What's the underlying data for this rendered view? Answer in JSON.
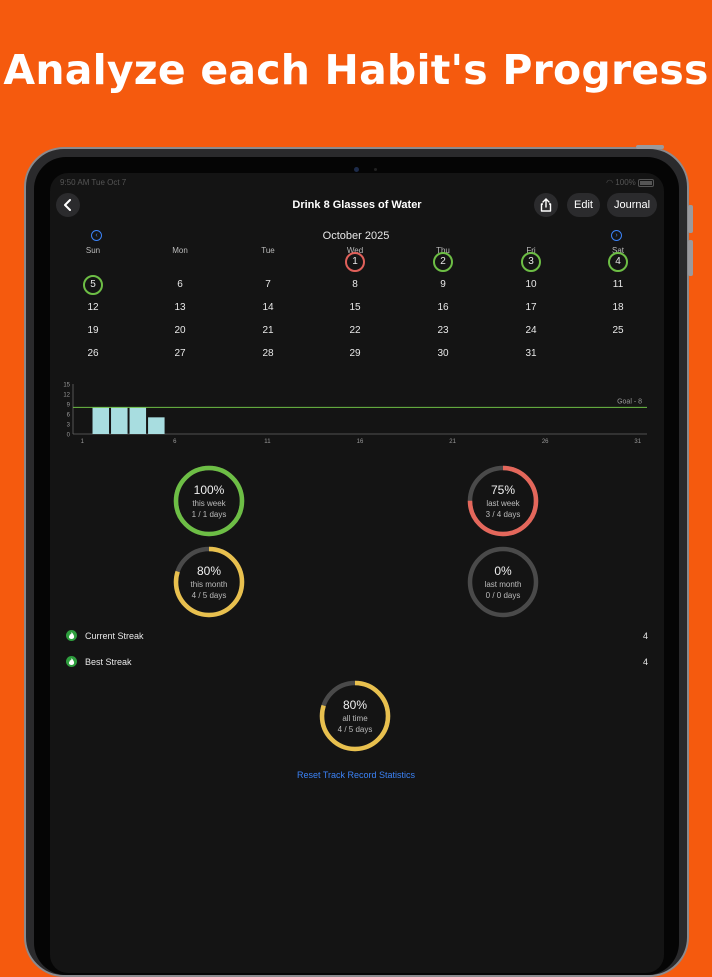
{
  "headline": "Analyze each Habit's Progress",
  "status": {
    "time": "9:50 AM  Tue Oct 7",
    "battery": "100%"
  },
  "nav": {
    "title": "Drink 8 Glasses of Water",
    "edit_label": "Edit",
    "journal_label": "Journal"
  },
  "calendar": {
    "month_label": "October 2025",
    "weekdays": [
      "Sun",
      "Mon",
      "Tue",
      "Wed",
      "Thu",
      "Fri",
      "Sat"
    ],
    "weeks": [
      [
        "",
        "",
        "",
        "1",
        "2",
        "3",
        "4"
      ],
      [
        "5",
        "6",
        "7",
        "8",
        "9",
        "10",
        "11"
      ],
      [
        "12",
        "13",
        "14",
        "15",
        "16",
        "17",
        "18"
      ],
      [
        "19",
        "20",
        "21",
        "22",
        "23",
        "24",
        "25"
      ],
      [
        "26",
        "27",
        "28",
        "29",
        "30",
        "31",
        ""
      ]
    ],
    "completed_days": [
      "2",
      "3",
      "4",
      "5"
    ],
    "missed_days": [
      "1"
    ]
  },
  "chart_data": {
    "type": "bar",
    "x": [
      1,
      2,
      3,
      4,
      5
    ],
    "values": [
      0,
      8,
      8,
      8,
      5
    ],
    "xticks": [
      1,
      6,
      11,
      16,
      21,
      26,
      31
    ],
    "yticks": [
      0,
      3,
      6,
      9,
      12,
      15
    ],
    "xlim": [
      0,
      31
    ],
    "ylim": [
      0,
      15
    ],
    "goal": 8,
    "goal_label": "Goal - 8",
    "bar_color": "#A8DDE0",
    "goal_color": "#6DBE45"
  },
  "stats": [
    {
      "id": "this-week",
      "percent": "100%",
      "label": "this week",
      "detail": "1 / 1 days",
      "fraction": 1.0,
      "color": "#6DBE45"
    },
    {
      "id": "last-week",
      "percent": "75%",
      "label": "last week",
      "detail": "3 / 4 days",
      "fraction": 0.75,
      "color": "#E4675B"
    },
    {
      "id": "this-month",
      "percent": "80%",
      "label": "this month",
      "detail": "4 / 5 days",
      "fraction": 0.8,
      "color": "#E8C04E"
    },
    {
      "id": "last-month",
      "percent": "0%",
      "label": "last month",
      "detail": "0 / 0 days",
      "fraction": 0.0,
      "color": "#555555"
    }
  ],
  "streaks": {
    "current_label": "Current Streak",
    "current_value": "4",
    "best_label": "Best Streak",
    "best_value": "4"
  },
  "all_time": {
    "percent": "80%",
    "label": "all time",
    "detail": "4 / 5 days",
    "fraction": 0.8,
    "color": "#E8C04E"
  },
  "reset_label": "Reset Track Record Statistics",
  "colors": {
    "background": "#F55A0E",
    "accent": "#3B82F6",
    "track": "#4a4a4a"
  }
}
